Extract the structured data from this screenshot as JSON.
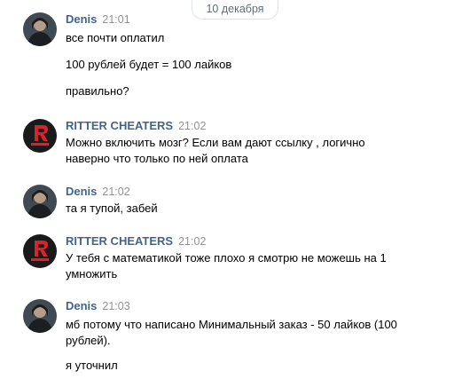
{
  "date_divider": "10 декабря",
  "messages": [
    {
      "author": "Denis",
      "time": "21:01",
      "avatar": "denis-avatar",
      "lines": [
        "все почти оплатил",
        "100 рублей будет = 100 лайков",
        "правильно?"
      ]
    },
    {
      "author": "RITTER CHEATERS",
      "time": "21:02",
      "avatar": "ritter-avatar",
      "lines": [
        "Можно включить мозг? Если вам дают ссылку , логично",
        "наверно что только по ней оплата"
      ]
    },
    {
      "author": "Denis",
      "time": "21:02",
      "avatar": "denis-avatar",
      "lines": [
        "та я тупой, забей"
      ]
    },
    {
      "author": "RITTER CHEATERS",
      "time": "21:02",
      "avatar": "ritter-avatar",
      "lines": [
        "У тебя с математикой тоже плохо я смотрю не можешь на 1",
        "умножить"
      ]
    },
    {
      "author": "Denis",
      "time": "21:03",
      "avatar": "denis-avatar",
      "lines": [
        "мб потому что написано Минимальный заказ - 50 лайков (100",
        "рублей).",
        "я уточнил"
      ]
    }
  ]
}
